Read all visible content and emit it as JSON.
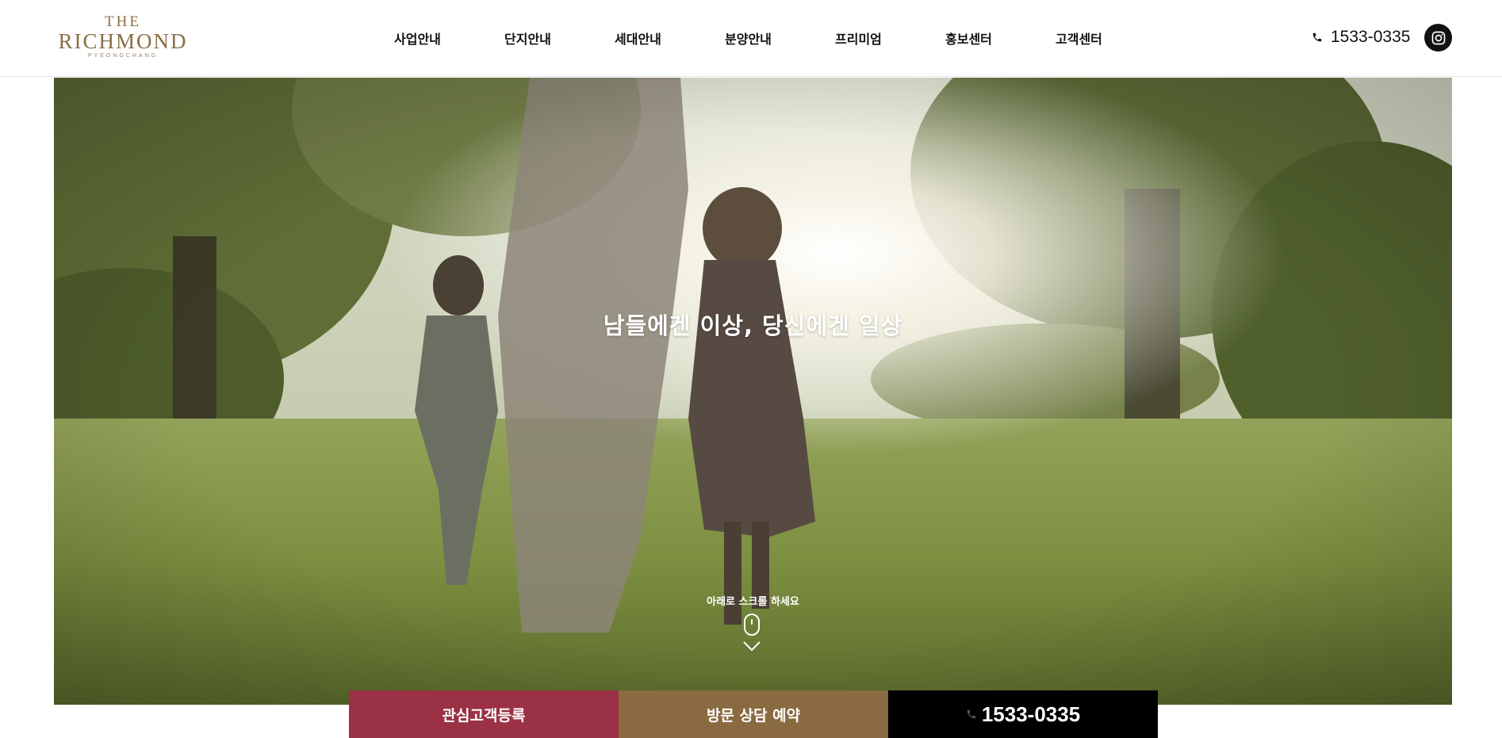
{
  "brand": {
    "logo_top": "THE",
    "logo_main": "RICHMOND",
    "logo_sub": "PYEONGCHANG",
    "color": "#8a6d45"
  },
  "nav": {
    "items": [
      {
        "label": "사업안내"
      },
      {
        "label": "단지안내"
      },
      {
        "label": "세대안내"
      },
      {
        "label": "분양안내"
      },
      {
        "label": "프리미엄"
      },
      {
        "label": "홍보센터"
      },
      {
        "label": "고객센터"
      }
    ]
  },
  "header": {
    "phone_icon": "phone-icon",
    "phone": "1533-0335",
    "social_icon": "instagram-icon"
  },
  "hero": {
    "headline": "남들에겐 이상, 당신에겐 일상",
    "scroll_hint": "아래로 스크롤 하세요",
    "mouse_icon": "mouse-icon",
    "chevron_icon": "chevron-down-icon"
  },
  "cta": {
    "register_label": "관심고객등록",
    "register_color": "#9b3145",
    "visit_label": "방문 상담 예약",
    "visit_color": "#8a6a40",
    "call_label": "1533-0335",
    "call_color": "#000000"
  }
}
